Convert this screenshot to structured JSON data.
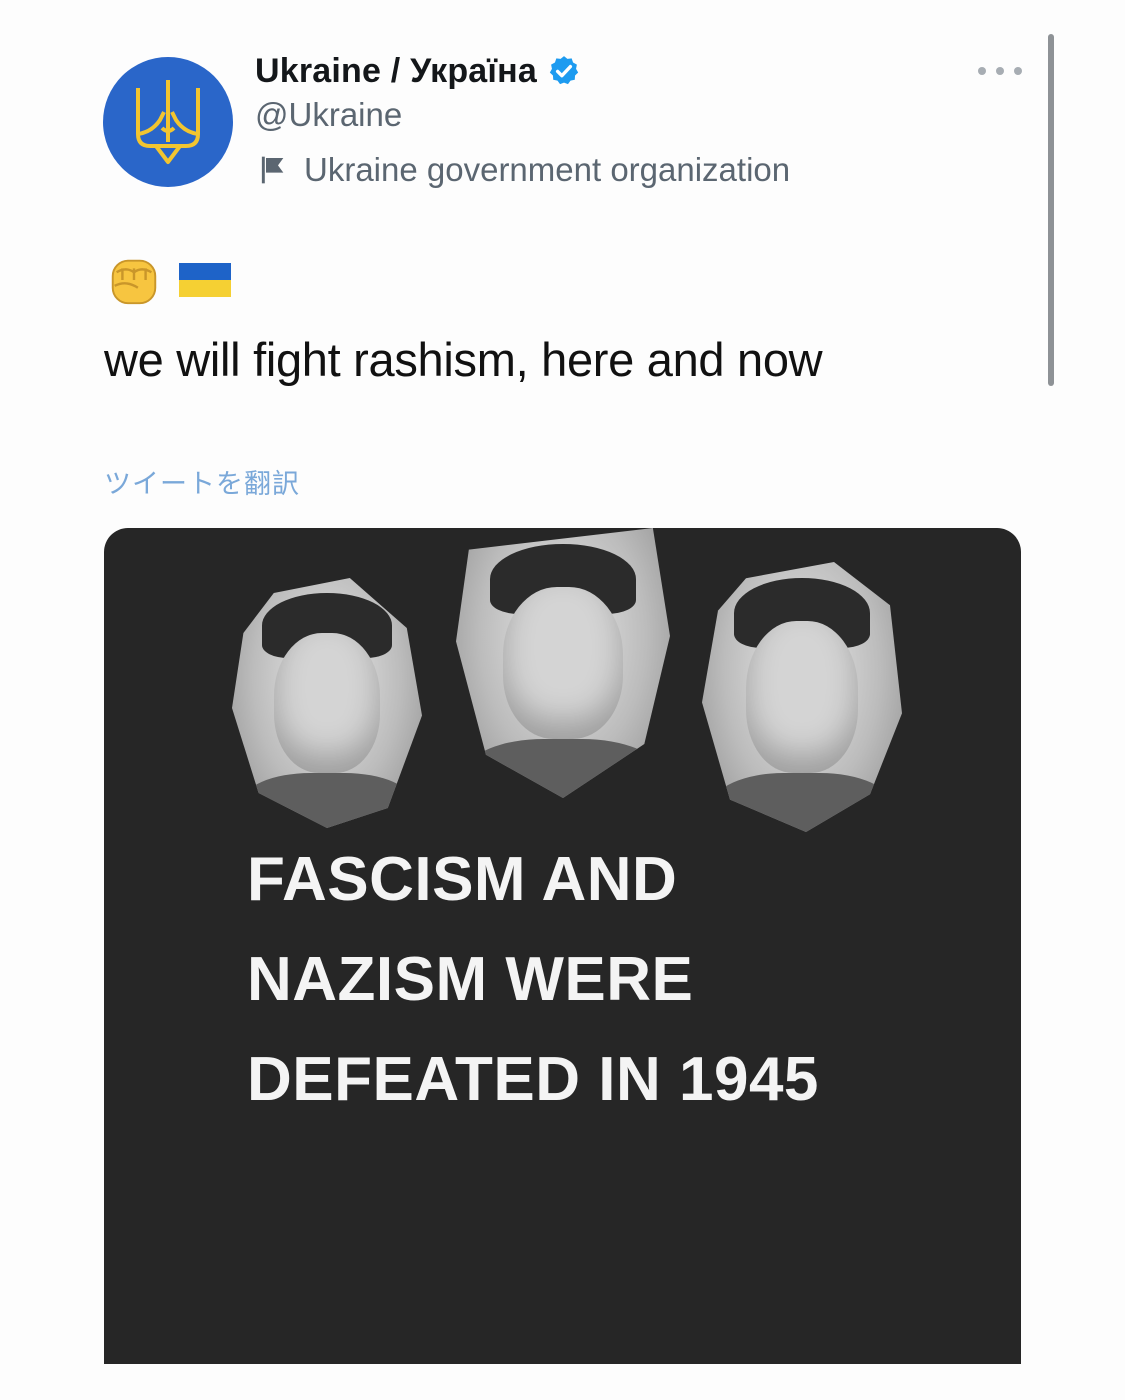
{
  "tweet": {
    "display_name": "Ukraine / Україна",
    "handle": "@Ukraine",
    "org_label": "Ukraine government organization",
    "text": "we will fight rashism, here and now",
    "translate_label": "ツイートを翻訳",
    "emojis": [
      "fist-icon",
      "ukraine-flag-icon"
    ]
  },
  "media": {
    "headline_lines": [
      "FASCISM AND",
      "NAZISM WERE",
      "DEFEATED IN 1945"
    ]
  },
  "colors": {
    "avatar_bg": "#2a66c9",
    "trident": "#f2c530",
    "verified": "#1d9bf0",
    "link": "#7aa8d9",
    "media_bg": "#262626"
  }
}
